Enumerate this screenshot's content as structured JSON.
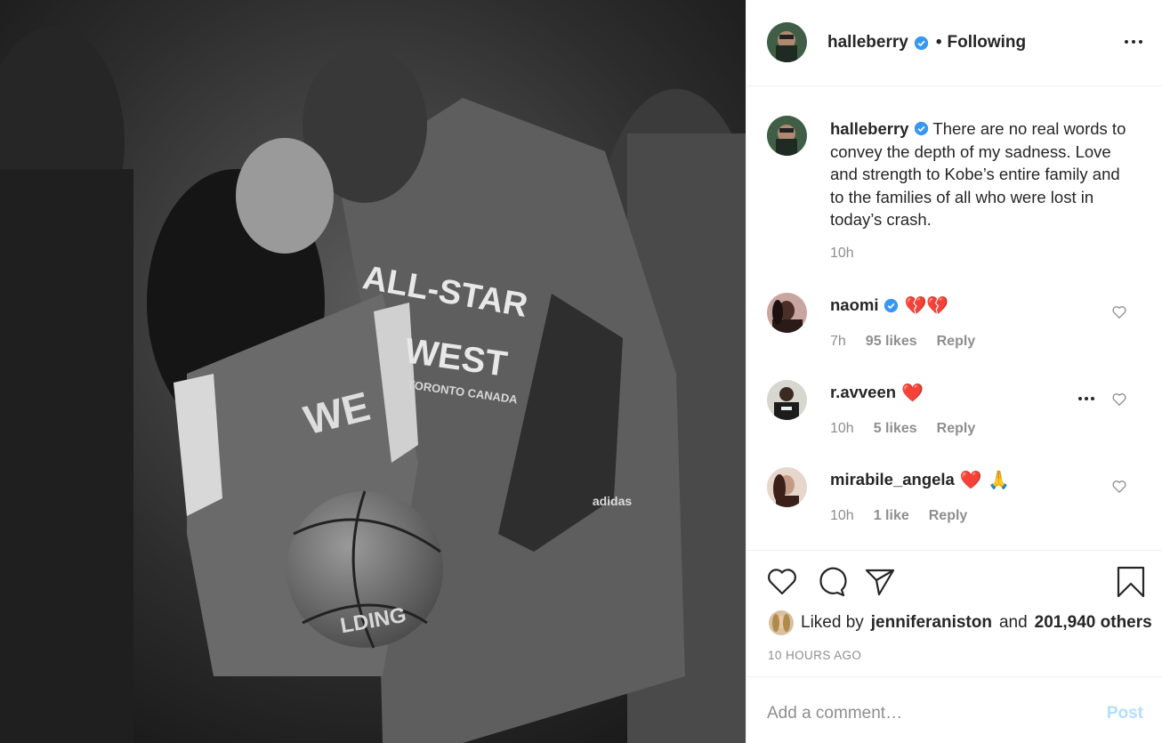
{
  "post": {
    "username": "halleberry",
    "separator": "•",
    "follow_status": "Following",
    "caption": "There are no real words to convey the depth of my sadness. Love and strength to Kobe’s entire family and to the families of all who were lost in today’s crash.",
    "caption_time": "10h",
    "liked_by_prefix": "Liked by",
    "liked_by_user": "jenniferaniston",
    "liked_by_and": "and",
    "liked_by_others": "201,940 others",
    "time_ago": "10 HOURS AGO",
    "photo_text": {
      "shirt_line1": "ALL-STAR",
      "shirt_line2": "WEST",
      "shirt_line3": "TORONTO CANADA",
      "jersey": "WE",
      "ball_text": "LDING",
      "brand": "adidas"
    }
  },
  "comments": [
    {
      "username": "naomi",
      "verified": true,
      "emoji": "💔💔",
      "time": "7h",
      "likes": "95 likes",
      "reply": "Reply"
    },
    {
      "username": "r.avveen",
      "verified": false,
      "emoji": "❤️",
      "time": "10h",
      "likes": "5 likes",
      "reply": "Reply"
    },
    {
      "username": "mirabile_angela",
      "verified": false,
      "emoji": "❤️ 🙏",
      "time": "10h",
      "likes": "1 like",
      "reply": "Reply"
    }
  ],
  "comment_box": {
    "placeholder": "Add a comment…",
    "post_label": "Post"
  },
  "icons": {
    "verified": "verified-badge-icon",
    "more": "more-options-icon",
    "like": "heart-icon",
    "comment": "comment-bubble-icon",
    "share": "paper-plane-icon",
    "save": "bookmark-icon"
  },
  "colors": {
    "verified": "#3897f0",
    "post_disabled": "#b2dffc",
    "meta_text": "#8e8e8e",
    "heart_emoji": "#e0245e"
  }
}
